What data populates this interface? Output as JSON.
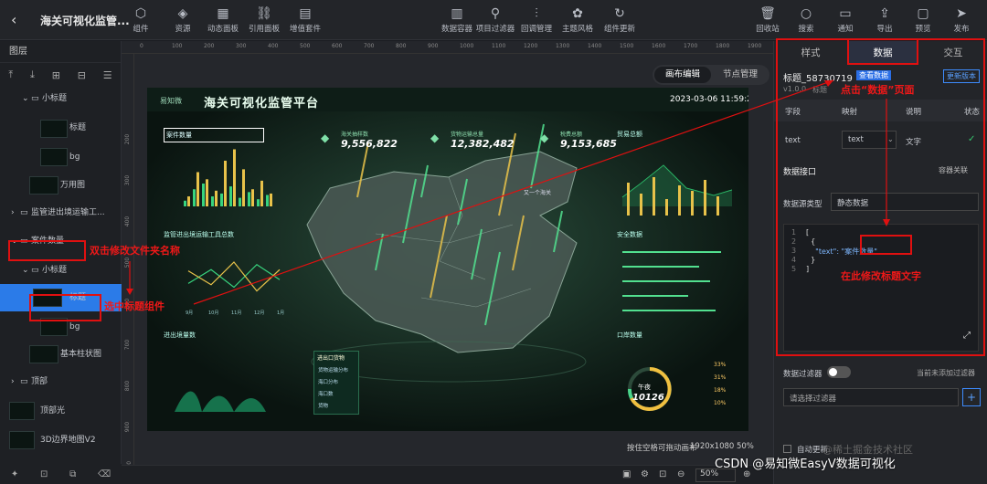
{
  "app": {
    "title": "海关可视化监管..."
  },
  "toolbar_left": [
    {
      "label": "组件",
      "icon": "component-icon",
      "glyph": "⬡"
    },
    {
      "label": "资源",
      "icon": "stack-icon",
      "glyph": "◈"
    },
    {
      "label": "动态面板",
      "icon": "panel-icon",
      "glyph": "▦"
    },
    {
      "label": "引用面板",
      "icon": "link-icon",
      "glyph": "⛓"
    },
    {
      "label": "增值套件",
      "icon": "grid-icon",
      "glyph": "▤"
    }
  ],
  "toolbar_mid": [
    {
      "label": "数据容器",
      "icon": "data-container-icon",
      "glyph": "▥"
    },
    {
      "label": "项目过滤器",
      "icon": "filter-icon",
      "glyph": "⚲"
    },
    {
      "label": "回调管理",
      "icon": "sliders-icon",
      "glyph": "⫶"
    },
    {
      "label": "主题风格",
      "icon": "theme-icon",
      "glyph": "✿"
    },
    {
      "label": "组件更新",
      "icon": "refresh-icon",
      "glyph": "↻"
    }
  ],
  "toolbar_right": [
    {
      "label": "回收站",
      "icon": "trash-icon",
      "glyph": "🗑"
    },
    {
      "label": "搜索",
      "icon": "search-icon",
      "glyph": "○"
    },
    {
      "label": "通知",
      "icon": "message-icon",
      "glyph": "▭"
    },
    {
      "label": "导出",
      "icon": "export-icon",
      "glyph": "⇪"
    },
    {
      "label": "预览",
      "icon": "preview-icon",
      "glyph": "▢"
    },
    {
      "label": "发布",
      "icon": "send-icon",
      "glyph": "➤"
    }
  ],
  "layers": {
    "header": "图层",
    "items": [
      {
        "label": "小标题"
      },
      {
        "label": "标题"
      },
      {
        "label": "bg"
      },
      {
        "label": "万用图"
      },
      {
        "label": "监管进出境运输工..."
      },
      {
        "label": "案件数量"
      },
      {
        "label": "小标题"
      },
      {
        "label": "标题"
      },
      {
        "label": "bg"
      },
      {
        "label": "基本柱状图"
      },
      {
        "label": "顶部"
      },
      {
        "label": "顶部光"
      },
      {
        "label": "3D边界地图V2"
      }
    ]
  },
  "canvas": {
    "mode_active": "画布编辑",
    "mode_other": "节点管理",
    "hint": "按住空格可拖动画布",
    "size": "1920x1080 50%",
    "zoom": "50%",
    "ruler_marks": [
      "0",
      "100",
      "200",
      "300",
      "400",
      "500",
      "600",
      "700",
      "800",
      "900",
      "1000",
      "1100",
      "1200",
      "1300",
      "1400",
      "1500",
      "1600",
      "1700",
      "1800",
      "1900"
    ],
    "ruler_left_marks": [
      "200",
      "300",
      "400",
      "500",
      "600",
      "700",
      "800",
      "900",
      "1000"
    ]
  },
  "screen": {
    "logo": "易知微",
    "title": "海关可视化监管平台",
    "datetime": "2023-03-06 11:59:25",
    "stats": [
      {
        "k": "海关抽样数",
        "v": "9,556,822"
      },
      {
        "k": "货物运输总量",
        "v": "12,382,482"
      },
      {
        "k": "税费总额",
        "v": "9,153,685"
      }
    ],
    "panel_case": "案件数量",
    "panel_transport": "监管进出境运输工具总数",
    "panel_port": "口岸数量",
    "panel_trade": "贸易总额",
    "panel_security": "安全数据",
    "panel_ratio": "进出境量数",
    "tag": "又一个海关",
    "center_box": "进出口货物",
    "center_items": [
      "货物运输分布",
      "海口分布",
      "海口数",
      "货物"
    ],
    "case_legend": [
      "案件",
      "案件二"
    ],
    "case_x": [
      "0-1k",
      "4-7k",
      "10-15k",
      "15k以上"
    ],
    "donut_label": "午夜",
    "donut_value": "10126",
    "legend_pct": [
      "33%",
      "31%",
      "18%",
      "10%"
    ],
    "line_x": [
      "9月",
      "10月",
      "11月",
      "12月",
      "1月"
    ],
    "bar_h_values": [
      "100",
      "100",
      "100",
      "100"
    ]
  },
  "panel": {
    "tabs": [
      "样式",
      "数据",
      "交互"
    ],
    "component": "标题_58730719",
    "view_data": "查看数据",
    "version": "v1.0.0",
    "category": "标题",
    "update_version": "更新版本",
    "fields_header": [
      "字段",
      "映射",
      "说明",
      "状态"
    ],
    "field_row": {
      "field": "text",
      "map": "text",
      "desc": "文字"
    },
    "data_api_title": "数据接口",
    "container_link": "容器关联",
    "source_type_label": "数据源类型",
    "source_type_value": "静态数据",
    "code_lines": [
      "1",
      "2",
      "3",
      "4",
      "5"
    ],
    "code": [
      "[",
      "  {",
      "    \"text\": \"案件数量\"",
      "  }",
      "]"
    ],
    "filter_label": "数据过滤器",
    "filter_hint": "当前未添加过滤器",
    "filter_placeholder": "请选择过滤器",
    "auto_update": "自动更新"
  },
  "annotations": {
    "click_data": "点击“数据”页面",
    "rename": "双击修改文件夹名称",
    "select": "选中标题组件",
    "edit_text": "在此修改标题文字"
  },
  "watermark": "CSDN @易知微EasyV数据可视化",
  "watermark2": "@稀土掘金技术社区",
  "chart_case": {
    "type": "bar",
    "series": [
      {
        "values": [
          20,
          60,
          80,
          35,
          45,
          70,
          30,
          50,
          25,
          40
        ]
      },
      {
        "values": [
          35,
          120,
          95,
          55,
          160,
          200,
          130,
          60,
          90,
          45
        ]
      }
    ],
    "ylim": [
      0,
      240
    ]
  },
  "chart_line": {
    "type": "line",
    "x": [
      "9月",
      "10月",
      "11月",
      "12月",
      "1月"
    ],
    "series": [
      {
        "values": [
          150,
          260,
          120,
          300,
          180
        ]
      },
      {
        "values": [
          250,
          140,
          320,
          90,
          260
        ]
      }
    ],
    "ylim": [
      0,
      400
    ]
  }
}
